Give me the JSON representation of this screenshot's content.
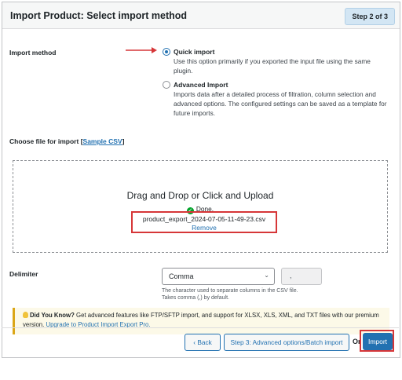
{
  "header": {
    "title": "Import Product: Select import method",
    "step": "Step 2 of 3"
  },
  "import_method": {
    "label": "Import method",
    "options": [
      {
        "title": "Quick import",
        "description": "Use this option primarily if you exported the input file using the same plugin.",
        "selected": true
      },
      {
        "title": "Advanced Import",
        "description": "Imports data after a detailed process of filtration, column selection and advanced options. The configured settings can be saved as a template for future imports.",
        "selected": false
      }
    ]
  },
  "file": {
    "label": "Choose file for import",
    "sample_link": "Sample CSV",
    "dropzone_title": "Drag and Drop or Click and Upload",
    "status": "Done.",
    "filename": "product_export_2024-07-05-11-49-23.csv",
    "remove": "Remove"
  },
  "delimiter": {
    "label": "Delimiter",
    "selected": "Comma",
    "value": ",",
    "help_line1": "The character used to separate columns in the CSV file.",
    "help_line2": "Takes comma (,) by default."
  },
  "notice": {
    "bold": "Did You Know?",
    "text": " Get advanced features like FTP/SFTP import, and support for XLSX, XLS, XML, and TXT files with our premium version. ",
    "link": "Upgrade to Product Import Export Pro."
  },
  "footer": {
    "back": "Back",
    "next": "Step 3: Advanced options/Batch import",
    "or": "Or",
    "import": "Import"
  },
  "colors": {
    "accent": "#2271b1",
    "highlight": "#d63638",
    "notice_border": "#dba617"
  }
}
